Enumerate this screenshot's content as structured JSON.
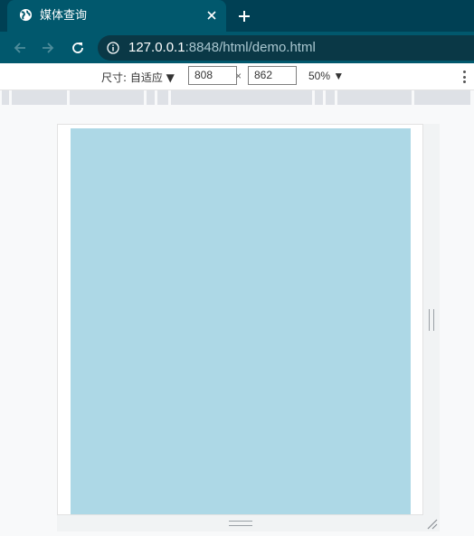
{
  "tab": {
    "title": "媒体查询",
    "favicon": "globe-icon"
  },
  "address_bar": {
    "host": "127.0.0.1",
    "rest": ":8848/html/demo.html"
  },
  "device_toolbar": {
    "size_label": "尺寸: 自适应 ▼",
    "width": "808",
    "separator": "×",
    "height": "862",
    "zoom": "50% ▼"
  },
  "page": {
    "background_color": "#add8e6"
  },
  "colors": {
    "chrome_frame": "#004054",
    "chrome_toolbar": "#01586d"
  }
}
